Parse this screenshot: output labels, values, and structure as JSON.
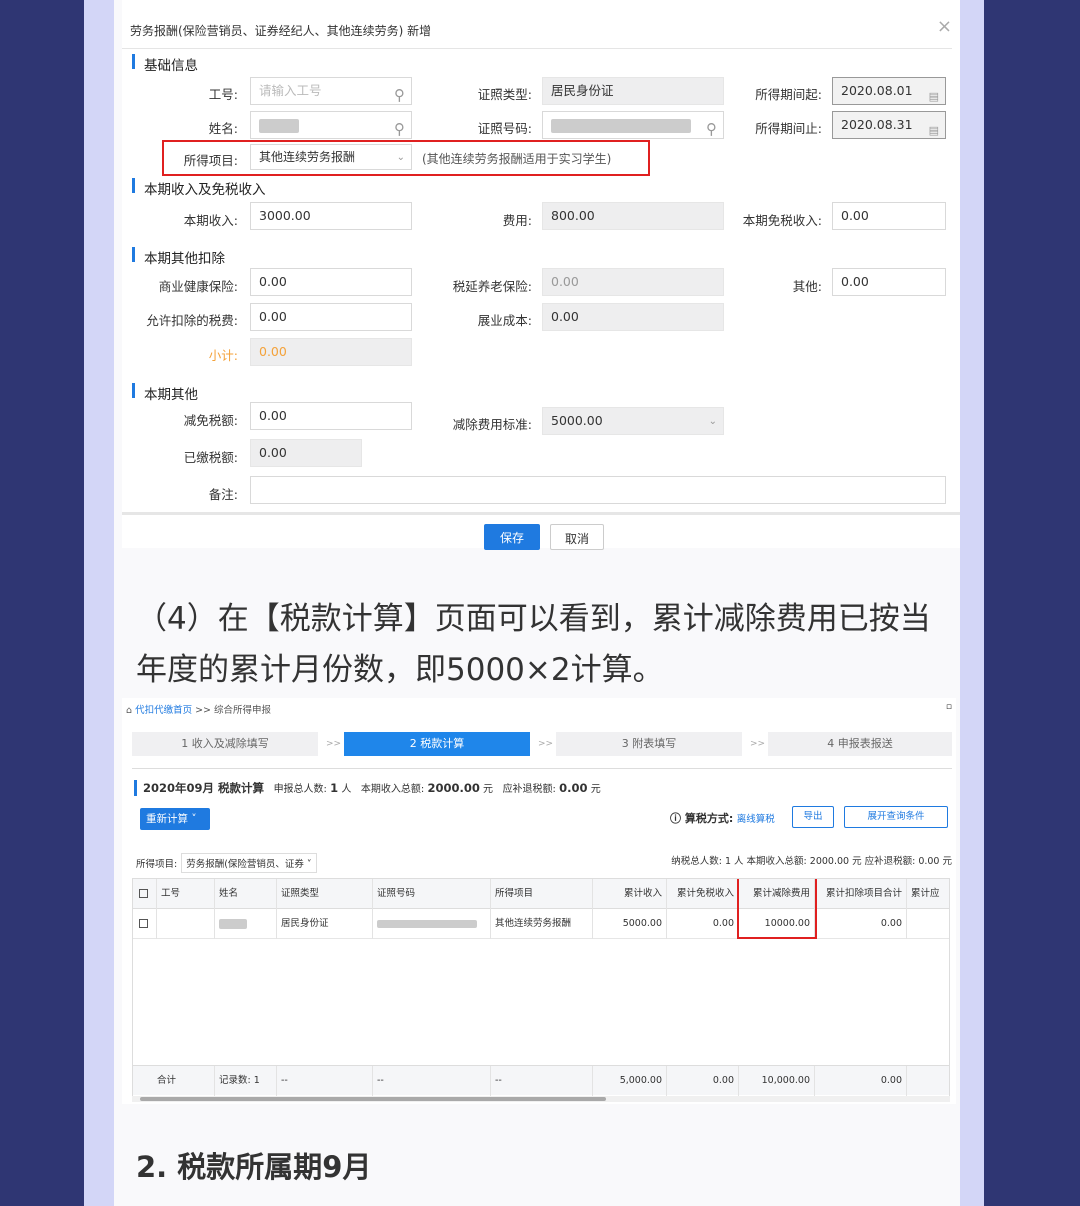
{
  "dialog": {
    "title": "劳务报酬(保险营销员、证券经纪人、其他连续劳务) 新增",
    "close": "×",
    "sections": {
      "basic": "基础信息",
      "income": "本期收入及免税收入",
      "other_deduct": "本期其他扣除",
      "other": "本期其他"
    },
    "fields": {
      "emp_no_label": "工号:",
      "emp_no_placeholder": "请输入工号",
      "id_type_label": "证照类型:",
      "id_type_value": "居民身份证",
      "period_start_label": "所得期间起:",
      "period_start_value": "2020.08.01",
      "name_label": "姓名:",
      "id_no_label": "证照号码:",
      "period_end_label": "所得期间止:",
      "period_end_value": "2020.08.31",
      "item_label": "所得项目:",
      "item_value": "其他连续劳务报酬",
      "item_hint": "(其他连续劳务报酬适用于实习学生)",
      "income_label": "本期收入:",
      "income_value": "3000.00",
      "expense_label": "费用:",
      "expense_value": "800.00",
      "tax_free_label": "本期免税收入:",
      "tax_free_value": "0.00",
      "health_ins_label": "商业健康保险:",
      "health_ins_value": "0.00",
      "pension_label": "税延养老保险:",
      "pension_value": "0.00",
      "others_label": "其他:",
      "others_value": "0.00",
      "allowed_tax_label": "允许扣除的税费:",
      "allowed_tax_value": "0.00",
      "business_cost_label": "展业成本:",
      "business_cost_value": "0.00",
      "subtotal_label": "小计:",
      "subtotal_value": "0.00",
      "relief_label": "减免税额:",
      "relief_value": "0.00",
      "deduct_std_label": "减除费用标准:",
      "deduct_std_value": "5000.00",
      "paid_tax_label": "已缴税额:",
      "paid_tax_value": "0.00",
      "remark_label": "备注:"
    },
    "buttons": {
      "save": "保存",
      "cancel": "取消"
    }
  },
  "article": {
    "paragraph": "（4）在【税款计算】页面可以看到，累计减除费用已按当年度的累计月份数，即5000×2计算。",
    "heading": "2. 税款所属期9月"
  },
  "screenshot2": {
    "breadcrumb_home": "代扣代缴首页",
    "breadcrumb_sep": " >> ",
    "breadcrumb_current": "综合所得申报",
    "breadcrumb_end": "▫",
    "steps": [
      "1 收入及减除填写",
      "2 税款计算",
      "3 附表填写",
      "4 申报表报送"
    ],
    "step_sep": ">>",
    "summary_title": "2020年09月 税款计算",
    "summary_people_label": "申报总人数:",
    "summary_people_value": "1",
    "summary_people_unit": "人",
    "summary_income_label": "本期收入总额:",
    "summary_income_value": "2000.00",
    "summary_income_unit": "元",
    "summary_tax_label": "应补退税额:",
    "summary_tax_value": "0.00",
    "summary_tax_unit": "元",
    "recalc_button": "重新计算 ˅",
    "method_label": "ⓘ 算税方式:",
    "method_value": "离线算税",
    "export_button": "导出",
    "expand_button": "展开查询条件",
    "filter_label": "所得项目:",
    "filter_value": "劳务报酬(保险营销员、证券 ˅",
    "totals_text": "纳税总人数: 1 人   本期收入总额: 2000.00 元   应补退税额: 0.00 元",
    "columns": [
      "",
      "工号",
      "姓名",
      "证照类型",
      "证照号码",
      "所得项目",
      "累计收入",
      "累计免税收入",
      "累计减除费用",
      "累计扣除项目合计",
      "累计应"
    ],
    "row": {
      "id_type": "居民身份证",
      "item": "其他连续劳务报酬",
      "cum_income": "5000.00",
      "cum_tax_free": "0.00",
      "cum_deduct": "10000.00",
      "cum_items": "0.00"
    },
    "footer": {
      "total_label": "合计",
      "record_count": "记录数: 1",
      "dash": "--",
      "cum_income": "5,000.00",
      "cum_tax_free": "0.00",
      "cum_deduct": "10,000.00",
      "cum_items": "0.00"
    }
  },
  "colors": {
    "accent": "#1f7ae0",
    "highlight_box": "#e02020",
    "frame_outer": "#2f3673",
    "frame_inner": "#d3d6f7"
  }
}
